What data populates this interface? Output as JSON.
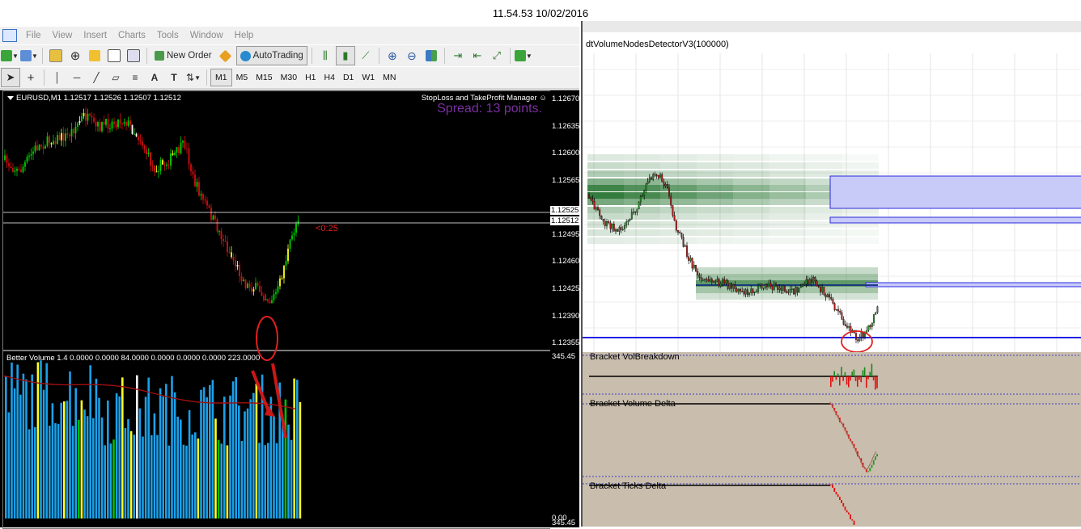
{
  "screen": {
    "timestamp": "11.54.53 10/02/2016"
  },
  "mt4": {
    "menu": [
      "File",
      "View",
      "Insert",
      "Charts",
      "Tools",
      "Window",
      "Help"
    ],
    "toolbar": {
      "new_order_label": "New Order",
      "autotrading_label": "AutoTrading"
    },
    "timeframes": [
      "M1",
      "M5",
      "M15",
      "M30",
      "H1",
      "H4",
      "D1",
      "W1",
      "MN"
    ],
    "active_timeframe": "M1",
    "chart": {
      "symbol_info": "EURUSD,M1  1.12517 1.12526 1.12507 1.12512",
      "sltp_manager": "StopLoss and TakeProfit Manager",
      "spread_text": "Spread: 13 points.",
      "bar_timer": "<0:25",
      "price_labels": [
        "1.12670",
        "1.12635",
        "1.12600",
        "1.12565",
        "1.12525",
        "1.12512",
        "1.12495",
        "1.12460",
        "1.12425",
        "1.12390",
        "1.12355"
      ],
      "highlighted_prices": [
        "1.12525",
        "1.12512"
      ]
    },
    "volume_indicator": {
      "title": "Better Volume 1.4  0.0000  0.0000  84.0000  0.0000  0.0000  0.0000  223.0000",
      "scale_top": "345.45",
      "scale_bottom": "0.00",
      "scale_bottom_overlap": "345.45"
    },
    "colors": {
      "bull": "#00d000",
      "bear": "#d01010",
      "climax": "#ffff20",
      "vol_blue": "#1aa0e8",
      "vol_ma": "#a01010"
    }
  },
  "ninja": {
    "indicator_title": "dtVolumeNodesDetectorV3(100000)",
    "panes": [
      {
        "label": "Bracket VolBreakdown"
      },
      {
        "label": "Bracket Volume Delta"
      },
      {
        "label": "Bracket Ticks Delta"
      }
    ],
    "colors": {
      "zone_fill": "#c8caf8",
      "zone_border": "#2b2be0",
      "node_green": "#1d6e28",
      "pane_bg": "#c9bdad"
    }
  },
  "annotations": {
    "circle_color": "#e02020",
    "arrow_color": "#c81818"
  }
}
